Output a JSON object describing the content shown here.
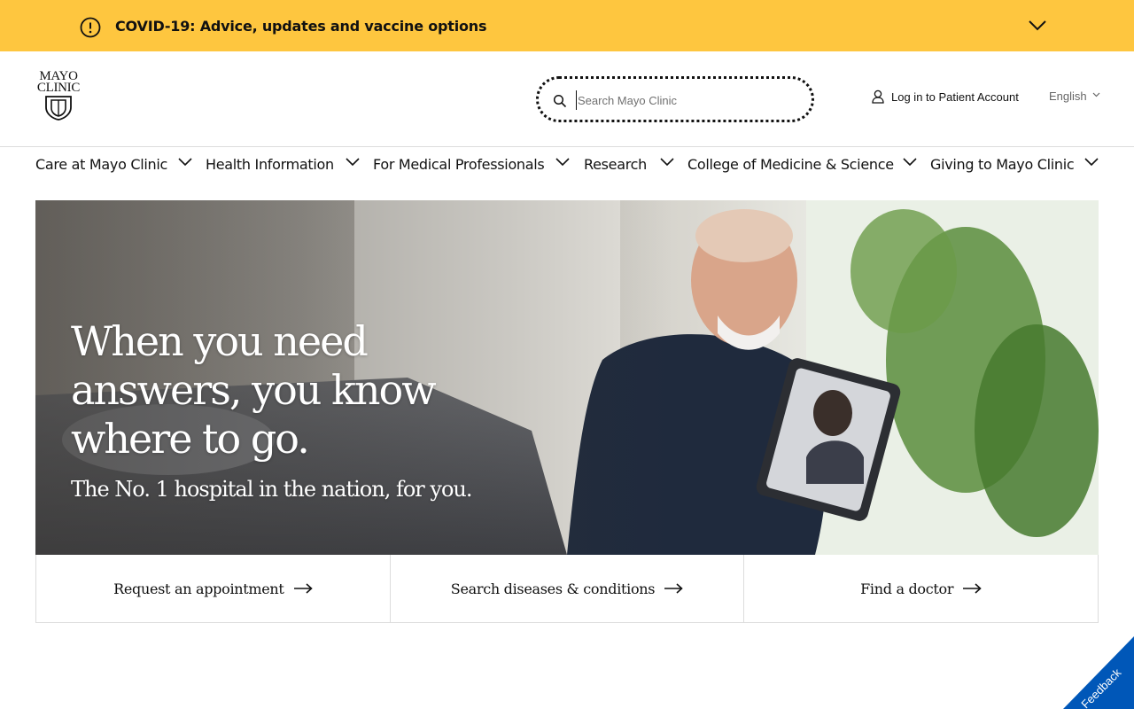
{
  "banner": {
    "text": "COVID-19: Advice, updates and vaccine options",
    "alert_icon": "exclamation-circle-icon",
    "toggle_icon": "chevron-down-icon",
    "background": "#fec63f"
  },
  "header": {
    "logo": {
      "line1": "MAYO",
      "line2": "CLINIC"
    },
    "search": {
      "placeholder": "Search Mayo Clinic",
      "icon": "search-icon"
    },
    "login": {
      "label": "Log in to Patient Account",
      "icon": "user-icon"
    },
    "language": {
      "label": "English",
      "icon": "chevron-down-icon"
    }
  },
  "nav": {
    "items": [
      {
        "label": "Care at Mayo Clinic"
      },
      {
        "label": "Health Information"
      },
      {
        "label": "For Medical Professionals"
      },
      {
        "label": "Research"
      },
      {
        "label": "College of Medicine & Science"
      },
      {
        "label": "Giving to Mayo Clinic"
      }
    ]
  },
  "hero": {
    "headline": "When you need answers, you know where to go.",
    "subheadline": "The No. 1 hospital in the nation, for you."
  },
  "quicklinks": [
    {
      "label": "Request an appointment"
    },
    {
      "label": "Search diseases & conditions"
    },
    {
      "label": "Find a doctor"
    }
  ],
  "feedback": {
    "label": "Feedback",
    "color": "#0057b8"
  }
}
